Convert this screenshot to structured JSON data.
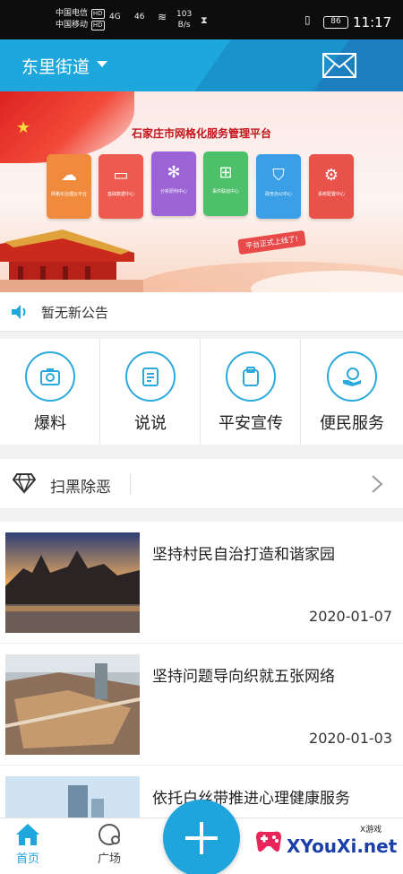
{
  "status_bar": {
    "carrier1": "中国电信",
    "carrier2": "中国移动",
    "hd": "HD",
    "signal1": "4G",
    "signal2": "46",
    "speed_value": "103",
    "speed_unit": "B/s",
    "battery": "86",
    "time": "11:17"
  },
  "header": {
    "district": "东里街道",
    "icons": [
      "chevron-down-icon",
      "mail-icon"
    ]
  },
  "banner": {
    "title": "石家庄市网格化服务管理平台",
    "tiles": [
      {
        "label": "网格化治理云平台",
        "color": "#f08a3c",
        "icon": "cloud-icon"
      },
      {
        "label": "基础数据中心",
        "color": "#ee5a4f",
        "icon": "monitor-icon"
      },
      {
        "label": "分析研判中心",
        "color": "#9b63d6",
        "icon": "network-icon"
      },
      {
        "label": "事件联动中心",
        "color": "#4fc06a",
        "icon": "grid-icon"
      },
      {
        "label": "政务办公中心",
        "color": "#3b9fe6",
        "icon": "shield-icon"
      },
      {
        "label": "系统配置中心",
        "color": "#e8524a",
        "icon": "gear-icon"
      }
    ],
    "badge": "平台正式上线了!"
  },
  "notice": {
    "text": "暂无新公告"
  },
  "actions": [
    {
      "label": "爆料",
      "icon": "camera-icon"
    },
    {
      "label": "说说",
      "icon": "notepad-icon"
    },
    {
      "label": "平安宣传",
      "icon": "clipboard-icon"
    },
    {
      "label": "便民服务",
      "icon": "hand-service-icon"
    }
  ],
  "crime_section": {
    "title": "扫黑除恶"
  },
  "news": [
    {
      "title": "坚持村民自治打造和谐家园",
      "date": "2020-01-07"
    },
    {
      "title": "坚持问题导向织就五张网络",
      "date": "2020-01-03"
    },
    {
      "title": "依托白丝带推进心理健康服务",
      "date": ""
    }
  ],
  "bottom_nav": {
    "home": "首页",
    "square": "广场"
  },
  "watermark": {
    "brand": "XYouXi.net",
    "small": "X游戏"
  },
  "colors": {
    "accent": "#1ea7dc",
    "header": "#1ea7dc"
  }
}
